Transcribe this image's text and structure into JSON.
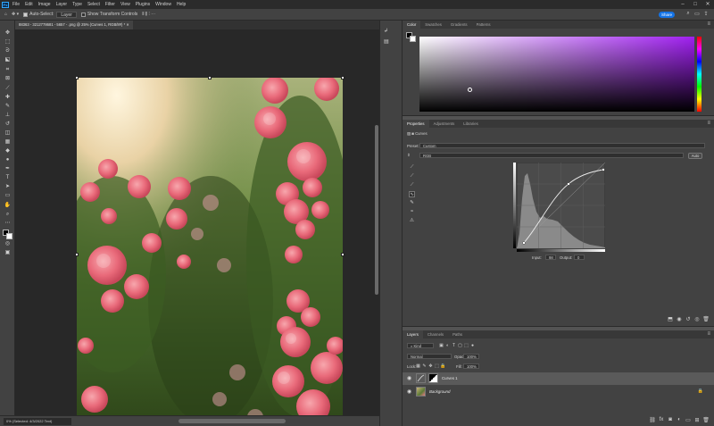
{
  "menubar": {
    "app_icon": "Ps",
    "items": [
      "File",
      "Edit",
      "Image",
      "Layer",
      "Type",
      "Select",
      "Filter",
      "View",
      "Plugins",
      "Window",
      "Help"
    ],
    "window_controls": [
      "minimize-icon",
      "maximize-icon",
      "close-icon"
    ]
  },
  "options_bar": {
    "auto_select_label": "Auto-Select:",
    "auto_select_target": "Layer",
    "show_transform_label": "Show Transform Controls",
    "share_label": "Share"
  },
  "document": {
    "tab_title": "88363 - 3212778681 - 5657 - .png @ 25% (Curves 1, RGB/8#) *"
  },
  "status_bar": {
    "text": "0% (Selected: 4/3/2022 Text)"
  },
  "color_panel": {
    "tabs": [
      "Color",
      "Swatches",
      "Gradients",
      "Patterns"
    ],
    "active_tab": "Color",
    "hue_color": "#a020f0",
    "foreground": "#000000",
    "background": "#ffffff"
  },
  "properties_panel": {
    "tabs": [
      "Properties",
      "Adjustments",
      "Libraries"
    ],
    "active_tab": "Properties",
    "adjustment_title": "Curves",
    "preset_label": "Preset:",
    "preset_value": "Custom",
    "channel_value": "RGB",
    "auto_label": "Auto",
    "input_label": "Input:",
    "input_value": "98",
    "output_label": "Output:",
    "output_value": "0"
  },
  "layers_panel": {
    "tabs": [
      "Layers",
      "Channels",
      "Paths"
    ],
    "active_tab": "Layers",
    "filter_label": "Kind",
    "blend_mode": "Normal",
    "opacity_label": "Opacity:",
    "opacity_value": "100%",
    "lock_label": "Lock:",
    "fill_label": "Fill:",
    "fill_value": "100%",
    "layers": [
      {
        "name": "Curves 1",
        "type": "adjustment",
        "visible": true,
        "selected": true
      },
      {
        "name": "Background",
        "type": "image",
        "visible": true,
        "locked": true
      }
    ]
  },
  "colors": {
    "accent": "#1473e6",
    "panel_bg": "#424242",
    "canvas_bg": "#282828"
  }
}
